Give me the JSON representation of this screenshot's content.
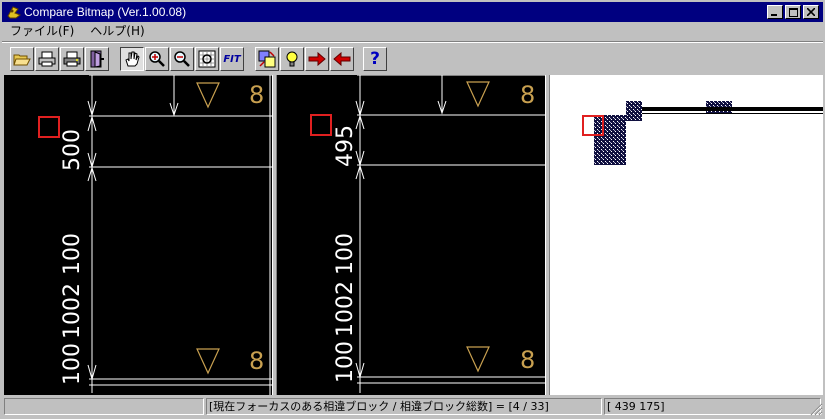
{
  "window": {
    "title": "Compare Bitmap  (Ver.1.00.08)",
    "controls": [
      "_",
      "□",
      "×"
    ]
  },
  "menu": [
    {
      "label": "ファイル(F)"
    },
    {
      "label": "ヘルプ(H)"
    }
  ],
  "toolbar": {
    "buttons": [
      {
        "name": "open-icon"
      },
      {
        "name": "print-icon"
      },
      {
        "name": "print-setup-icon"
      },
      {
        "name": "exit-door-icon"
      },
      {
        "name": "hand-pan-icon",
        "pressed": true
      },
      {
        "name": "zoom-in-icon"
      },
      {
        "name": "zoom-out-icon"
      },
      {
        "name": "zoom-window-icon"
      },
      {
        "name": "fit-icon",
        "label": "FIT"
      },
      {
        "name": "compare-icon"
      },
      {
        "name": "bulb-icon"
      },
      {
        "name": "next-diff-icon"
      },
      {
        "name": "prev-diff-icon"
      },
      {
        "name": "help-icon",
        "label": "?"
      }
    ]
  },
  "panels": {
    "left": {
      "dimension_labels": [
        "500",
        "100",
        "1002",
        "100"
      ],
      "corner_labels": [
        "8",
        "8"
      ]
    },
    "middle": {
      "dimension_labels": [
        "495",
        "100",
        "1002",
        "100"
      ],
      "corner_labels": [
        "8",
        "8"
      ]
    }
  },
  "status": {
    "message": "[現在フォーカスのある相違ブロック / 相違ブロック総数] = [4 / 33]",
    "coords": "[ 439   175]"
  },
  "colors": {
    "title_bar": "#000080",
    "face": "#c0c0c0",
    "drawing_bg": "#000000",
    "drawing_lines": "#ffffff",
    "highlight_box": "#e02020",
    "label_gold": "#c8a050"
  }
}
